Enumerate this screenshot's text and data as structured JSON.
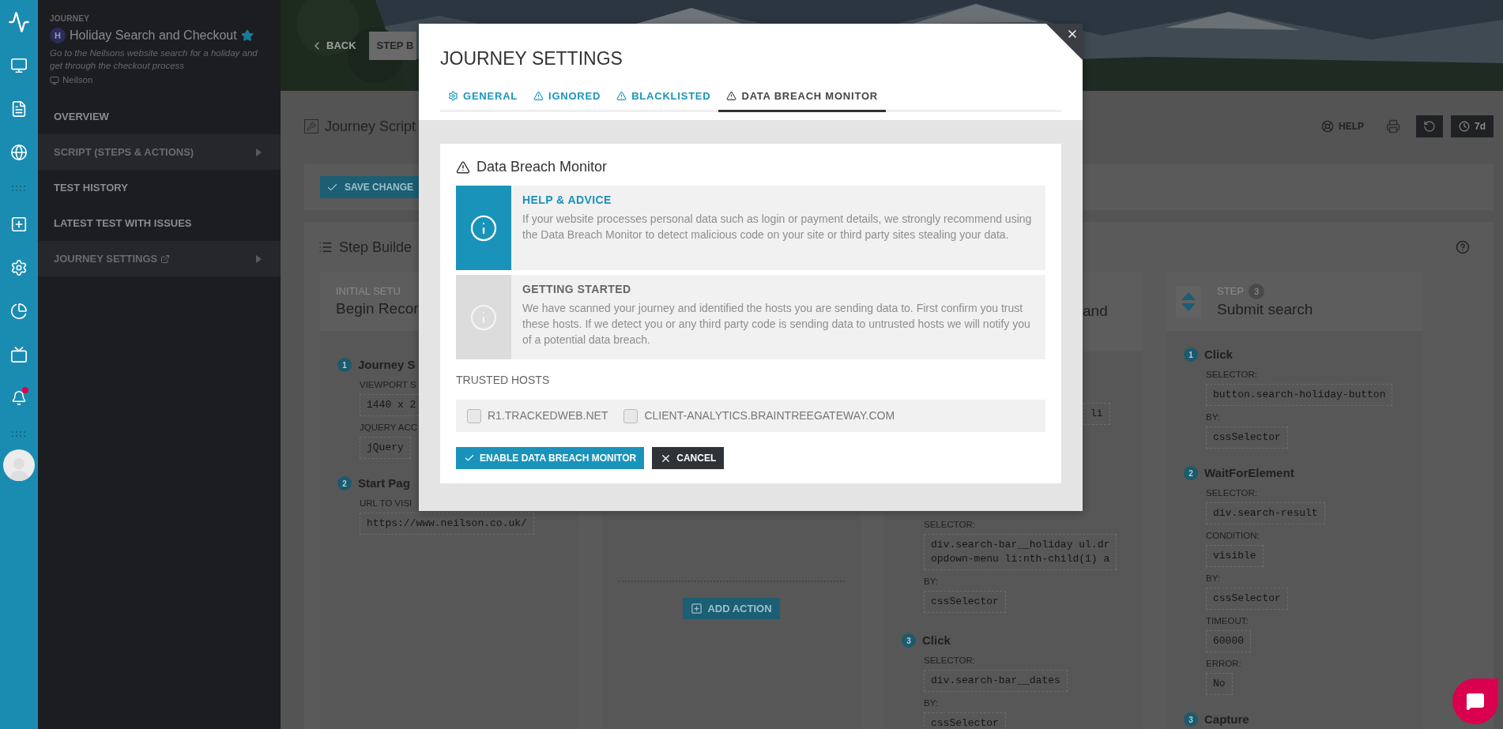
{
  "rail": {
    "notification": true
  },
  "sidebar": {
    "eyebrow": "JOURNEY",
    "avatar_letter": "H",
    "title": "Holiday Search and Checkout",
    "starred": true,
    "description": "Go to the Neilsons website search for a holiday and get through the checkout process",
    "site": "Neilson",
    "menu": [
      {
        "label": "OVERVIEW",
        "expandable": false,
        "external": false
      },
      {
        "label": "SCRIPT (STEPS & ACTIONS)",
        "expandable": true,
        "external": false
      },
      {
        "label": "TEST HISTORY",
        "expandable": false,
        "external": false
      },
      {
        "label": "LATEST TEST WITH ISSUES",
        "expandable": false,
        "external": false
      },
      {
        "label": "JOURNEY SETTINGS",
        "expandable": true,
        "external": true
      }
    ]
  },
  "header": {
    "back": "BACK",
    "step_button": "STEP B"
  },
  "toolbar": {
    "title": "Journey Script",
    "help": "HELP",
    "range": "7d"
  },
  "save_button": "SAVE CHANGE",
  "step_builder": {
    "title": "Step Builde",
    "column_1": {
      "eyebrow": "INITIAL SETU",
      "title": "Begin Recor",
      "actions": [
        {
          "number": "1",
          "name": "Journey S",
          "fields": [
            {
              "label": "VIEWPORT S",
              "value": "1440 x 2"
            },
            {
              "label": "JQUERY ACC",
              "value": "jQuery"
            }
          ]
        },
        {
          "number": "2",
          "name": "Start Pag",
          "fields": [
            {
              "label": "URL TO VISI",
              "value": "https://www.neilson.co.uk/"
            }
          ]
        }
      ]
    },
    "column_2": {
      "add_action": "ADD ACTION"
    },
    "column_3": {
      "title_fragment": "and",
      "code_fragment": "li",
      "fields": [
        {
          "label": "SELECTOR:",
          "value": "div.search-bar__holiday ul.dropdown-menu li:nth-child(1) a"
        },
        {
          "label": "BY:",
          "value": "cssSelector"
        }
      ],
      "actions": [
        {
          "number": "3",
          "name": "Click",
          "fields": [
            {
              "label": "SELECTOR:",
              "value": "div.search-bar__dates"
            },
            {
              "label": "BY:",
              "value": "cssSelector"
            }
          ]
        }
      ]
    },
    "column_4": {
      "step_label": "STEP",
      "step_number": "3",
      "title": "Submit search",
      "actions": [
        {
          "number": "1",
          "name": "Click",
          "fields": [
            {
              "label": "SELECTOR:",
              "value": "button.search-holiday-button"
            },
            {
              "label": "BY:",
              "value": "cssSelector"
            }
          ]
        },
        {
          "number": "2",
          "name": "WaitForElement",
          "fields": [
            {
              "label": "SELECTOR:",
              "value": "div.search-result"
            },
            {
              "label": "CONDITION:",
              "value": "visible"
            },
            {
              "label": "BY:",
              "value": "cssSelector"
            },
            {
              "label": "TIMEOUT:",
              "value": "60000"
            },
            {
              "label": "ERROR:",
              "value": "No"
            }
          ]
        },
        {
          "number": "3",
          "name": "Capture"
        }
      ]
    }
  },
  "modal": {
    "title": "JOURNEY SETTINGS",
    "tabs": [
      {
        "label": "GENERAL",
        "kind": "general",
        "selected": false
      },
      {
        "label": "IGNORED",
        "kind": "warning",
        "selected": false
      },
      {
        "label": "BLACKLISTED",
        "kind": "warning",
        "selected": false
      },
      {
        "label": "DATA BREACH MONITOR",
        "kind": "warning",
        "selected": true
      }
    ],
    "section": {
      "title": "Data Breach Monitor",
      "notices": [
        {
          "kind": "active",
          "heading": "HELP & ADVICE",
          "text": "If your website processes personal data such as login or payment details, we strongly recommend using the Data Breach Monitor to detect malicious code on your site or third party sites stealing your data."
        },
        {
          "kind": "inactive",
          "heading": "GETTING STARTED",
          "text": "We have scanned your journey and identified the hosts you are sending data to. First confirm you trust these hosts. If we detect you or any third party code is sending data to untrusted hosts we will notify you of a potential data breach."
        }
      ],
      "trusted_hosts_label": "TRUSTED HOSTS",
      "hosts": [
        {
          "label": "R1.TRACKEDWEB.NET",
          "checked": false
        },
        {
          "label": "CLIENT-ANALYTICS.BRAINTREEGATEWAY.COM",
          "checked": false
        }
      ],
      "enable_button": "ENABLE DATA BREACH MONITOR",
      "cancel_button": "CANCEL"
    }
  }
}
